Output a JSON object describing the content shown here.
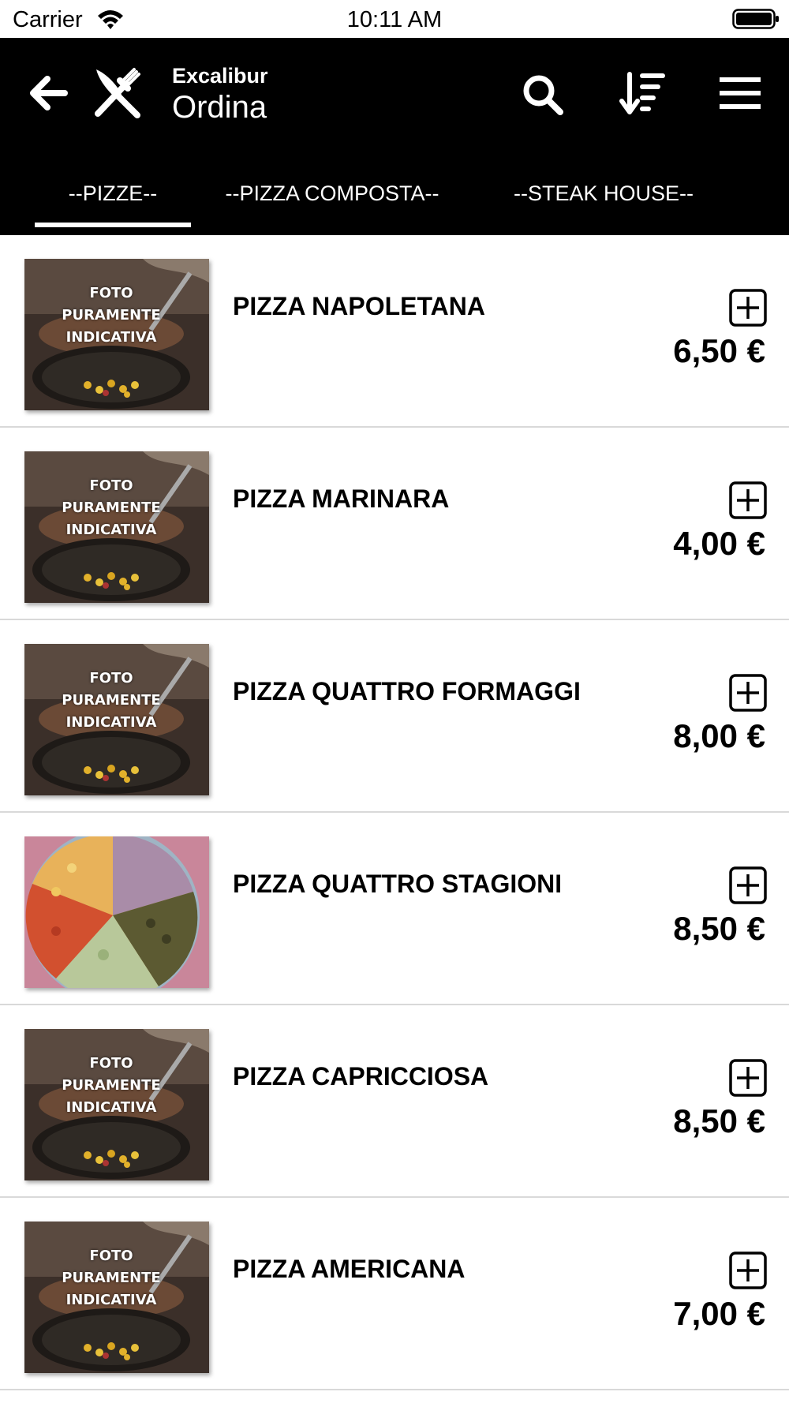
{
  "status_bar": {
    "carrier": "Carrier",
    "time": "10:11 AM"
  },
  "header": {
    "subtitle": "Excalibur",
    "title": "Ordina",
    "icons": [
      "back-icon",
      "restaurant-icon",
      "search-icon",
      "sort-icon",
      "menu-icon"
    ]
  },
  "tabs": [
    {
      "label": "--PIZZE--",
      "active": true
    },
    {
      "label": "--PIZZA COMPOSTA--",
      "active": false
    },
    {
      "label": "--STEAK HOUSE--",
      "active": false
    }
  ],
  "colors": {
    "header_bg": "#000000",
    "header_text": "#ffffff",
    "divider": "#d9d9d9",
    "text": "#000000"
  },
  "items": [
    {
      "name": "PIZZA NAPOLETANA",
      "price": "6,50 €",
      "thumb_caption": [
        "FOTO",
        "PURAMENTE",
        "INDICATIVA"
      ]
    },
    {
      "name": "PIZZA MARINARA",
      "price": "4,00 €",
      "thumb_caption": [
        "FOTO",
        "PURAMENTE",
        "INDICATIVA"
      ]
    },
    {
      "name": "PIZZA QUATTRO FORMAGGI",
      "price": "8,00 €",
      "thumb_caption": [
        "FOTO",
        "PURAMENTE",
        "INDICATIVA"
      ]
    },
    {
      "name": "PIZZA QUATTRO STAGIONI",
      "price": "8,50 €",
      "thumb_caption": []
    },
    {
      "name": "PIZZA CAPRICCIOSA",
      "price": "8,50 €",
      "thumb_caption": [
        "FOTO",
        "PURAMENTE",
        "INDICATIVA"
      ]
    },
    {
      "name": "PIZZA AMERICANA",
      "price": "7,00 €",
      "thumb_caption": [
        "FOTO",
        "PURAMENTE",
        "INDICATIVA"
      ]
    }
  ]
}
